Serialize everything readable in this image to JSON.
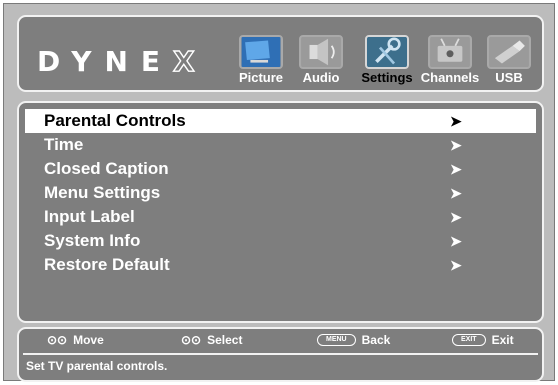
{
  "brand": {
    "logo_text": "DYNE",
    "logo_x": "X"
  },
  "tabs": [
    {
      "label": "Picture",
      "icon": "picture-icon",
      "active": false
    },
    {
      "label": "Audio",
      "icon": "audio-icon",
      "active": false
    },
    {
      "label": "Settings",
      "icon": "settings-icon",
      "active": true
    },
    {
      "label": "Channels",
      "icon": "channels-icon",
      "active": false
    },
    {
      "label": "USB",
      "icon": "usb-icon",
      "active": false
    }
  ],
  "menu": {
    "items": [
      {
        "label": "Parental Controls",
        "arrow": "➤",
        "selected": true
      },
      {
        "label": "Time",
        "arrow": "➤",
        "selected": false
      },
      {
        "label": "Closed Caption",
        "arrow": "➤",
        "selected": false
      },
      {
        "label": "Menu Settings",
        "arrow": "➤",
        "selected": false
      },
      {
        "label": "Input Label",
        "arrow": "➤",
        "selected": false
      },
      {
        "label": "System Info",
        "arrow": "➤",
        "selected": false
      },
      {
        "label": "Restore Default",
        "arrow": "➤",
        "selected": false
      }
    ]
  },
  "footer": {
    "hints": [
      {
        "glyph": "⊙⊙",
        "pill": "",
        "label": "Move"
      },
      {
        "glyph": "⊙⊙",
        "pill": "",
        "label": "Select"
      },
      {
        "glyph": "",
        "pill": "MENU",
        "label": "Back"
      },
      {
        "glyph": "",
        "pill": "EXIT",
        "label": "Exit"
      }
    ],
    "help_text": "Set TV parental controls."
  },
  "colors": {
    "background": "#bcbcbc",
    "panel": "#7e7e7e",
    "border": "#f2f2f2",
    "active_tab": "#3d6f8c",
    "highlight": "#ffffff"
  }
}
